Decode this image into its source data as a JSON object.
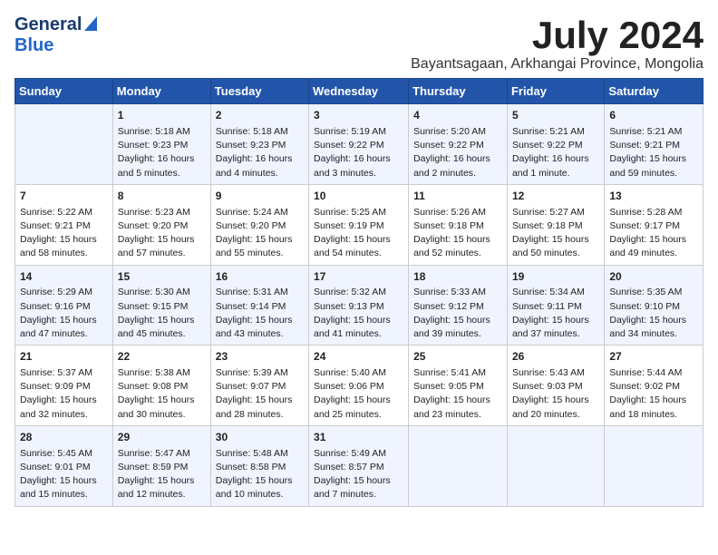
{
  "logo": {
    "general": "General",
    "blue": "Blue"
  },
  "title": "July 2024",
  "location": "Bayantsagaan, Arkhangai Province, Mongolia",
  "days_of_week": [
    "Sunday",
    "Monday",
    "Tuesday",
    "Wednesday",
    "Thursday",
    "Friday",
    "Saturday"
  ],
  "weeks": [
    [
      {
        "day": "",
        "sunrise": "",
        "sunset": "",
        "daylight": ""
      },
      {
        "day": "1",
        "sunrise": "Sunrise: 5:18 AM",
        "sunset": "Sunset: 9:23 PM",
        "daylight": "Daylight: 16 hours and 5 minutes."
      },
      {
        "day": "2",
        "sunrise": "Sunrise: 5:18 AM",
        "sunset": "Sunset: 9:23 PM",
        "daylight": "Daylight: 16 hours and 4 minutes."
      },
      {
        "day": "3",
        "sunrise": "Sunrise: 5:19 AM",
        "sunset": "Sunset: 9:22 PM",
        "daylight": "Daylight: 16 hours and 3 minutes."
      },
      {
        "day": "4",
        "sunrise": "Sunrise: 5:20 AM",
        "sunset": "Sunset: 9:22 PM",
        "daylight": "Daylight: 16 hours and 2 minutes."
      },
      {
        "day": "5",
        "sunrise": "Sunrise: 5:21 AM",
        "sunset": "Sunset: 9:22 PM",
        "daylight": "Daylight: 16 hours and 1 minute."
      },
      {
        "day": "6",
        "sunrise": "Sunrise: 5:21 AM",
        "sunset": "Sunset: 9:21 PM",
        "daylight": "Daylight: 15 hours and 59 minutes."
      }
    ],
    [
      {
        "day": "7",
        "sunrise": "Sunrise: 5:22 AM",
        "sunset": "Sunset: 9:21 PM",
        "daylight": "Daylight: 15 hours and 58 minutes."
      },
      {
        "day": "8",
        "sunrise": "Sunrise: 5:23 AM",
        "sunset": "Sunset: 9:20 PM",
        "daylight": "Daylight: 15 hours and 57 minutes."
      },
      {
        "day": "9",
        "sunrise": "Sunrise: 5:24 AM",
        "sunset": "Sunset: 9:20 PM",
        "daylight": "Daylight: 15 hours and 55 minutes."
      },
      {
        "day": "10",
        "sunrise": "Sunrise: 5:25 AM",
        "sunset": "Sunset: 9:19 PM",
        "daylight": "Daylight: 15 hours and 54 minutes."
      },
      {
        "day": "11",
        "sunrise": "Sunrise: 5:26 AM",
        "sunset": "Sunset: 9:18 PM",
        "daylight": "Daylight: 15 hours and 52 minutes."
      },
      {
        "day": "12",
        "sunrise": "Sunrise: 5:27 AM",
        "sunset": "Sunset: 9:18 PM",
        "daylight": "Daylight: 15 hours and 50 minutes."
      },
      {
        "day": "13",
        "sunrise": "Sunrise: 5:28 AM",
        "sunset": "Sunset: 9:17 PM",
        "daylight": "Daylight: 15 hours and 49 minutes."
      }
    ],
    [
      {
        "day": "14",
        "sunrise": "Sunrise: 5:29 AM",
        "sunset": "Sunset: 9:16 PM",
        "daylight": "Daylight: 15 hours and 47 minutes."
      },
      {
        "day": "15",
        "sunrise": "Sunrise: 5:30 AM",
        "sunset": "Sunset: 9:15 PM",
        "daylight": "Daylight: 15 hours and 45 minutes."
      },
      {
        "day": "16",
        "sunrise": "Sunrise: 5:31 AM",
        "sunset": "Sunset: 9:14 PM",
        "daylight": "Daylight: 15 hours and 43 minutes."
      },
      {
        "day": "17",
        "sunrise": "Sunrise: 5:32 AM",
        "sunset": "Sunset: 9:13 PM",
        "daylight": "Daylight: 15 hours and 41 minutes."
      },
      {
        "day": "18",
        "sunrise": "Sunrise: 5:33 AM",
        "sunset": "Sunset: 9:12 PM",
        "daylight": "Daylight: 15 hours and 39 minutes."
      },
      {
        "day": "19",
        "sunrise": "Sunrise: 5:34 AM",
        "sunset": "Sunset: 9:11 PM",
        "daylight": "Daylight: 15 hours and 37 minutes."
      },
      {
        "day": "20",
        "sunrise": "Sunrise: 5:35 AM",
        "sunset": "Sunset: 9:10 PM",
        "daylight": "Daylight: 15 hours and 34 minutes."
      }
    ],
    [
      {
        "day": "21",
        "sunrise": "Sunrise: 5:37 AM",
        "sunset": "Sunset: 9:09 PM",
        "daylight": "Daylight: 15 hours and 32 minutes."
      },
      {
        "day": "22",
        "sunrise": "Sunrise: 5:38 AM",
        "sunset": "Sunset: 9:08 PM",
        "daylight": "Daylight: 15 hours and 30 minutes."
      },
      {
        "day": "23",
        "sunrise": "Sunrise: 5:39 AM",
        "sunset": "Sunset: 9:07 PM",
        "daylight": "Daylight: 15 hours and 28 minutes."
      },
      {
        "day": "24",
        "sunrise": "Sunrise: 5:40 AM",
        "sunset": "Sunset: 9:06 PM",
        "daylight": "Daylight: 15 hours and 25 minutes."
      },
      {
        "day": "25",
        "sunrise": "Sunrise: 5:41 AM",
        "sunset": "Sunset: 9:05 PM",
        "daylight": "Daylight: 15 hours and 23 minutes."
      },
      {
        "day": "26",
        "sunrise": "Sunrise: 5:43 AM",
        "sunset": "Sunset: 9:03 PM",
        "daylight": "Daylight: 15 hours and 20 minutes."
      },
      {
        "day": "27",
        "sunrise": "Sunrise: 5:44 AM",
        "sunset": "Sunset: 9:02 PM",
        "daylight": "Daylight: 15 hours and 18 minutes."
      }
    ],
    [
      {
        "day": "28",
        "sunrise": "Sunrise: 5:45 AM",
        "sunset": "Sunset: 9:01 PM",
        "daylight": "Daylight: 15 hours and 15 minutes."
      },
      {
        "day": "29",
        "sunrise": "Sunrise: 5:47 AM",
        "sunset": "Sunset: 8:59 PM",
        "daylight": "Daylight: 15 hours and 12 minutes."
      },
      {
        "day": "30",
        "sunrise": "Sunrise: 5:48 AM",
        "sunset": "Sunset: 8:58 PM",
        "daylight": "Daylight: 15 hours and 10 minutes."
      },
      {
        "day": "31",
        "sunrise": "Sunrise: 5:49 AM",
        "sunset": "Sunset: 8:57 PM",
        "daylight": "Daylight: 15 hours and 7 minutes."
      },
      {
        "day": "",
        "sunrise": "",
        "sunset": "",
        "daylight": ""
      },
      {
        "day": "",
        "sunrise": "",
        "sunset": "",
        "daylight": ""
      },
      {
        "day": "",
        "sunrise": "",
        "sunset": "",
        "daylight": ""
      }
    ]
  ]
}
